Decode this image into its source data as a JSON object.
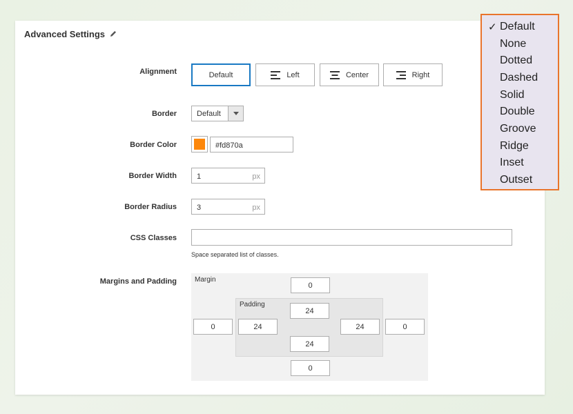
{
  "panel": {
    "title": "Advanced Settings"
  },
  "alignment": {
    "label": "Alignment",
    "options": [
      "Default",
      "Left",
      "Center",
      "Right"
    ],
    "selected": "Default"
  },
  "border": {
    "label": "Border",
    "value": "Default"
  },
  "border_color": {
    "label": "Border Color",
    "value": "#fd870a",
    "swatch": "#fd870a"
  },
  "border_width": {
    "label": "Border Width",
    "value": "1",
    "unit": "px"
  },
  "border_radius": {
    "label": "Border Radius",
    "value": "3",
    "unit": "px"
  },
  "css_classes": {
    "label": "CSS Classes",
    "value": "",
    "hint": "Space separated list of classes."
  },
  "margins_padding": {
    "label": "Margins and Padding",
    "margin_title": "Margin",
    "padding_title": "Padding",
    "margin": {
      "top": "0",
      "right": "0",
      "bottom": "0",
      "left": "0"
    },
    "padding": {
      "top": "24",
      "right": "24",
      "bottom": "24",
      "left": "24"
    }
  },
  "border_dropdown": {
    "check": "✓",
    "selected": "Default",
    "options": [
      "Default",
      "None",
      "Dotted",
      "Dashed",
      "Solid",
      "Double",
      "Groove",
      "Ridge",
      "Inset",
      "Outset"
    ]
  },
  "colors": {
    "accent": "#1979c3",
    "dropdown_border": "#e9742b",
    "dropdown_bg": "#e8e4ef"
  }
}
